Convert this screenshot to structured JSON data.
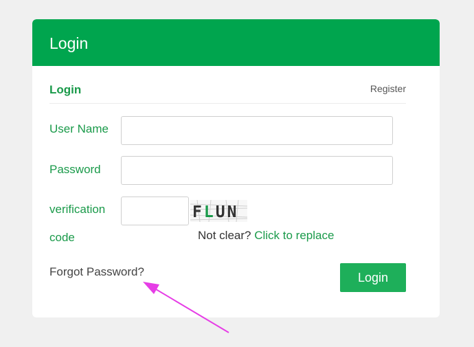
{
  "header": {
    "title": "Login"
  },
  "tabs": {
    "login": "Login",
    "register": "Register"
  },
  "form": {
    "username_label": "User Name",
    "username_value": "",
    "password_label": "Password",
    "password_value": "",
    "verification_label_line1": "verification",
    "verification_label_line2": "code",
    "verification_value": "",
    "captcha_text": "FLUN",
    "not_clear_text": "Not clear?",
    "replace_link": "Click to replace",
    "forgot_password": "Forgot Password?",
    "login_button": "Login"
  },
  "colors": {
    "header": "#00a54e",
    "accent_text": "#1a9a4a",
    "button": "#1eaf5a",
    "annotation_arrow": "#e63de6"
  }
}
